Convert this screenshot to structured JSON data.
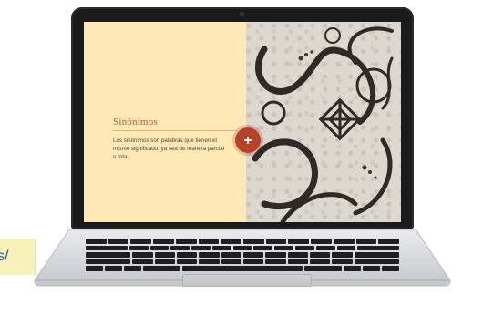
{
  "slide": {
    "title": "Sinónimos",
    "body": "Los sinónimos son palabras que tienen el mismo significado, ya sea de manera parcial o total."
  },
  "url_fragment": "s/",
  "icons": {
    "add_button": "plus-icon",
    "camera": "webcam-icon"
  },
  "colors": {
    "slide_background": "#fde8b6",
    "title": "#b05a2e",
    "accent_button": "#b5432a",
    "laptop_bezel": "#1b1b1d",
    "url_highlight": "#f6f2b9",
    "url_text": "#2a56a8"
  }
}
